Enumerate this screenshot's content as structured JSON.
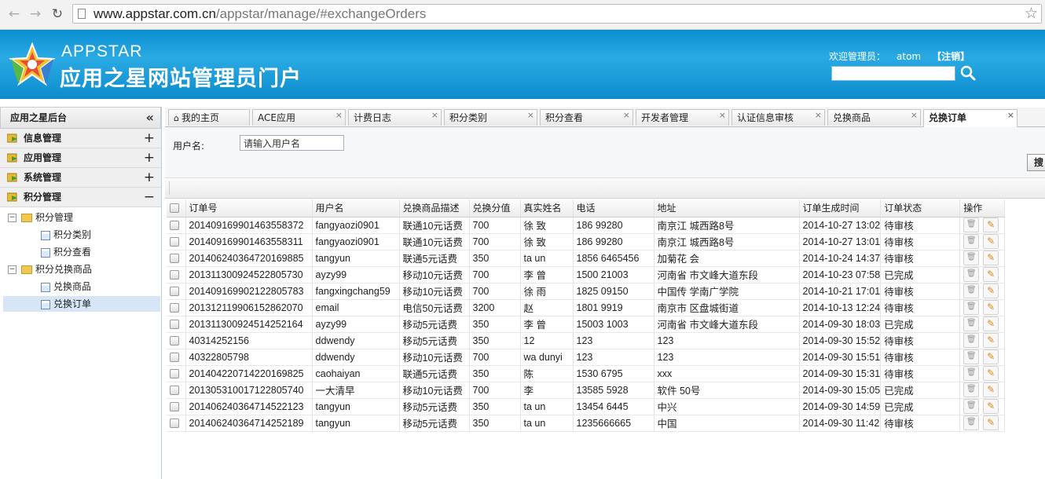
{
  "browser": {
    "url_host": "www.appstar.com.cn",
    "url_path": "/appstar/manage/#exchangeOrders"
  },
  "header": {
    "brand_en": "APPSTAR",
    "brand_cn": "应用之星网站管理员门户",
    "welcome_label": "欢迎管理员：",
    "username": "atom",
    "logout": "【注销】"
  },
  "sidebar": {
    "title": "应用之星后台",
    "sections": [
      {
        "label": "信息管理",
        "toggle": "+"
      },
      {
        "label": "应用管理",
        "toggle": "+"
      },
      {
        "label": "系统管理",
        "toggle": "+"
      },
      {
        "label": "积分管理",
        "toggle": "−"
      }
    ],
    "tree": {
      "group1": "积分管理",
      "g1_item1": "积分类别",
      "g1_item2": "积分查看",
      "group2": "积分兑换商品",
      "g2_item1": "兑换商品",
      "g2_item2": "兑换订单"
    }
  },
  "tabs": [
    {
      "label": "我的主页"
    },
    {
      "label": "ACE应用"
    },
    {
      "label": "计费日志"
    },
    {
      "label": "积分类别"
    },
    {
      "label": "积分查看"
    },
    {
      "label": "开发者管理"
    },
    {
      "label": "认证信息审核"
    },
    {
      "label": "兑换商品"
    },
    {
      "label": "兑换订单"
    }
  ],
  "filter": {
    "username_label": "用户名:",
    "username_placeholder": "请输入用户名",
    "search_button": "搜"
  },
  "table": {
    "headers": [
      "订单号",
      "用户名",
      "兑换商品描述",
      "兑换分值",
      "真实姓名",
      "电话",
      "地址",
      "订单生成时间",
      "订单状态",
      "操作"
    ],
    "rows": [
      [
        "20140916990146355837​2",
        "fangyaozi0901",
        "联通10元话费",
        "700",
        "徐 致",
        "186 99280",
        "南京江 城西路8号",
        "2014-10-27 13:02",
        "待审核"
      ],
      [
        "20140916990146355831​1",
        "fangyaozi0901",
        "联通10元话费",
        "700",
        "徐 致",
        "186 99280",
        "南京江 城西路8号",
        "2014-10-27 13:01",
        "待审核"
      ],
      [
        "20140624036472016988​5",
        "tangyun",
        "联通5元话费",
        "350",
        "ta un",
        "1856 6465456",
        "加菊花 会",
        "2014-10-24 14:37",
        "待审核"
      ],
      [
        "20131130092452280573​0",
        "ayzy99",
        "移动10元话费",
        "700",
        "李 曾",
        "1500 21003",
        "河南省 市文峰大道东段",
        "2014-10-23 07:58",
        "已完成"
      ],
      [
        "20140916990212280578​3",
        "fangxingchang59",
        "移动10元话费",
        "700",
        "徐 雨",
        "1825 09150",
        "中国传 学南广学院",
        "2014-10-21 17:01",
        "待审核"
      ],
      [
        "20131211990615286207​0",
        "email",
        "电信50元话费",
        "3200",
        "赵",
        "1801 9919",
        "南京市 区盘城街道",
        "2014-10-13 12:24",
        "待审核"
      ],
      [
        "20131130092451425216​4",
        "ayzy99",
        "移动5元话费",
        "350",
        "李 曾",
        "15003 1003",
        "河南省 市文峰大道东段",
        "2014-09-30 18:03",
        "已完成"
      ],
      [
        "40314252156",
        "ddwendy",
        "移动5元话费",
        "350",
        "12",
        "123",
        "123",
        "2014-09-30 15:52",
        "待审核"
      ],
      [
        "40322805798",
        "ddwendy",
        "移动10元话费",
        "700",
        "wa dunyi",
        "123",
        "123",
        "2014-09-30 15:51",
        "待审核"
      ],
      [
        "20140422071422016982​5",
        "caohaiyan",
        "联通5元话费",
        "350",
        "陈",
        "1530 6795",
        "xxx",
        "2014-09-30 15:31",
        "待审核"
      ],
      [
        "20130531001712280574​0",
        "一大清早",
        "移动10元话费",
        "700",
        "李",
        "13585 5928",
        "软件 50号",
        "2014-09-30 15:05",
        "已完成"
      ],
      [
        "20140624036471452212​3",
        "tangyun",
        "移动5元话费",
        "350",
        "ta un",
        "13454 6445",
        "中兴",
        "2014-09-30 14:59",
        "已完成"
      ],
      [
        "20140624036471425218​9",
        "tangyun",
        "移动5元话费",
        "350",
        "ta un",
        "1235666665",
        "中国",
        "2014-09-30 11:42",
        "待审核"
      ]
    ]
  },
  "colors": {
    "header_blue": "#1a9ad9",
    "sidebar_selected": "#d6e6f7"
  },
  "icons": {
    "back": "arrow-left-icon",
    "forward": "arrow-right-icon",
    "reload": "reload-icon",
    "star": "bookmark-star-icon",
    "delete": "trash-icon",
    "edit": "pencil-icon"
  }
}
